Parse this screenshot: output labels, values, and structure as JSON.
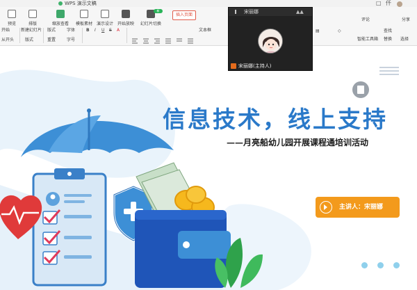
{
  "app": {
    "title": "WPS 演示文稿",
    "window_controls": [
      "□",
      "仟"
    ]
  },
  "ribbon": {
    "big_buttons": [
      {
        "label": "预览",
        "icon": "file-icon"
      },
      {
        "label": "排版",
        "icon": "layout-icon"
      },
      {
        "label": "缩放查看",
        "icon": "zoom-icon"
      },
      {
        "label": "模板素材",
        "icon": "template-icon"
      },
      {
        "label": "演示设计",
        "icon": "design-icon"
      },
      {
        "label": "开始放映",
        "icon": "play-icon"
      },
      {
        "label": "幻灯片切换",
        "icon": "transition-icon"
      }
    ],
    "new_badge": "新",
    "insert_button": "插入页面",
    "row2_tools": [
      "开始",
      "新建幻灯片",
      "版式",
      "字体",
      "B",
      "I",
      "U",
      "S",
      "A",
      "文本框"
    ],
    "row3_tools": [
      "从开头",
      "版式",
      "重置",
      "字号"
    ],
    "right_tools": {
      "share": "分享",
      "comments": "评论",
      "smart_tools": "智能工具箱",
      "find": "查找",
      "replace": "替换",
      "select": "选择"
    }
  },
  "video": {
    "top_name": "宋丽娜",
    "bottom_name": "宋丽娜(主持人)"
  },
  "slide": {
    "main_title": "信息技术，线上支持",
    "subtitle": "——月亮船幼儿园开展课程通培训活动",
    "speaker_label": "主讲人：宋丽娜",
    "colors": {
      "title_blue": "#2a79c9",
      "umbrella_blue": "#3d8fd6",
      "wallet_blue": "#1f55b8",
      "heart_red": "#e03a3a",
      "accent_orange": "#f39a1c",
      "coin_gold": "#f6b81d",
      "leaf_green": "#2fa24b"
    }
  },
  "pagination": {
    "dots": 3
  }
}
